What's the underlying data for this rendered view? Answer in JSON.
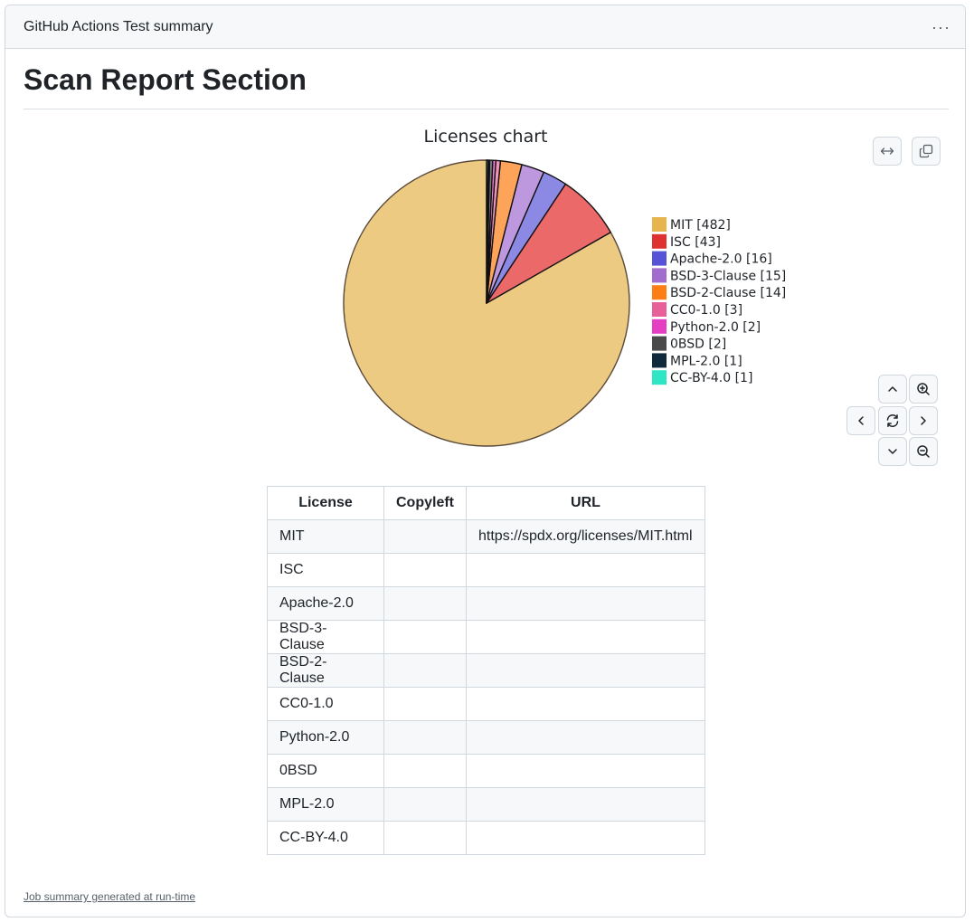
{
  "header": {
    "title": "GitHub Actions Test summary",
    "menu_label": "···"
  },
  "page": {
    "title": "Scan Report Section"
  },
  "chart_data": {
    "type": "pie",
    "title": "Licenses chart",
    "categories": [
      "MIT",
      "ISC",
      "Apache-2.0",
      "BSD-3-Clause",
      "BSD-2-Clause",
      "CC0-1.0",
      "Python-2.0",
      "0BSD",
      "MPL-2.0",
      "CC-BY-4.0"
    ],
    "values": [
      482,
      43,
      16,
      15,
      14,
      3,
      2,
      2,
      1,
      1
    ],
    "legend_labels": [
      "MIT [482]",
      "ISC [43]",
      "Apache-2.0 [16]",
      "BSD-3-Clause [15]",
      "BSD-2-Clause [14]",
      "CC0-1.0 [3]",
      "Python-2.0 [2]",
      "0BSD [2]",
      "MPL-2.0 [1]",
      "CC-BY-4.0 [1]"
    ],
    "legend_colors": [
      "#e8b44e",
      "#e03131",
      "#5753d6",
      "#a26ccf",
      "#fd7e14",
      "#e8609a",
      "#e63ec3",
      "#4a4a4a",
      "#0f2a3d",
      "#2ee6c4"
    ],
    "slice_colors": [
      "#edca82",
      "#ec6969",
      "#8c89e4",
      "#bd98df",
      "#fea45a",
      "#ef93b8",
      "#ef7ed7",
      "#7d7d7d",
      "#27475e",
      "#6cf0d7"
    ],
    "legend_position": "right"
  },
  "controls": {
    "expand_icon": "arrows-horizontal-icon",
    "copy_icon": "copy-icon",
    "pan_up_icon": "chevron-up-icon",
    "pan_down_icon": "chevron-down-icon",
    "pan_left_icon": "chevron-left-icon",
    "pan_right_icon": "chevron-right-icon",
    "reset_icon": "sync-icon",
    "zoom_in_icon": "zoom-in-icon",
    "zoom_out_icon": "zoom-out-icon"
  },
  "table": {
    "headers": [
      "License",
      "Copyleft",
      "URL"
    ],
    "rows": [
      [
        "MIT",
        "",
        "https://spdx.org/licenses/MIT.html"
      ],
      [
        "ISC",
        "",
        ""
      ],
      [
        "Apache-2.0",
        "",
        ""
      ],
      [
        "BSD-3-Clause",
        "",
        ""
      ],
      [
        "BSD-2-Clause",
        "",
        ""
      ],
      [
        "CC0-1.0",
        "",
        ""
      ],
      [
        "Python-2.0",
        "",
        ""
      ],
      [
        "0BSD",
        "",
        ""
      ],
      [
        "MPL-2.0",
        "",
        ""
      ],
      [
        "CC-BY-4.0",
        "",
        ""
      ]
    ]
  },
  "footer": {
    "link_text": "Job summary generated at run-time"
  }
}
